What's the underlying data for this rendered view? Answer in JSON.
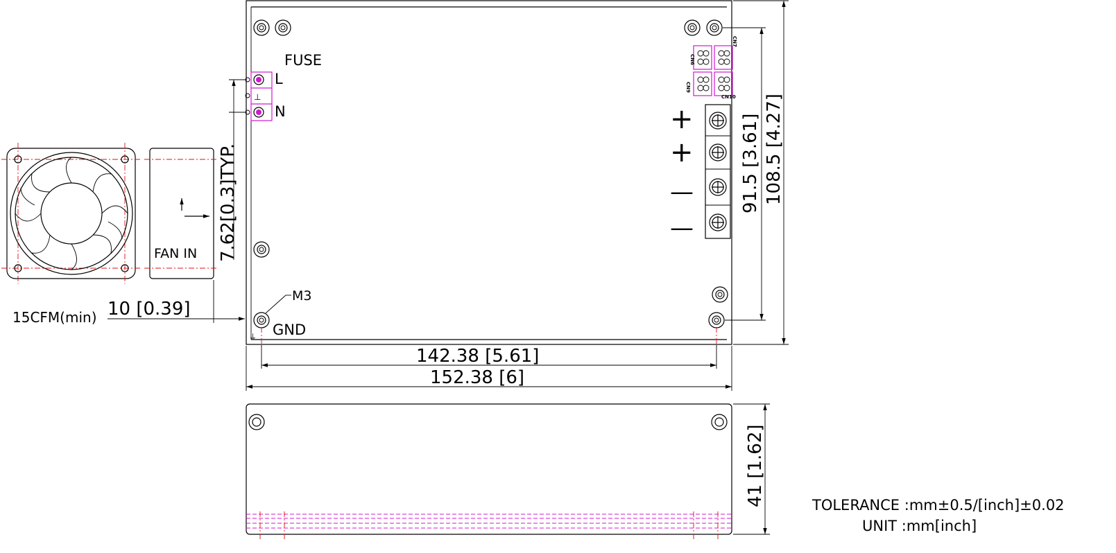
{
  "labels": {
    "fuse": "FUSE",
    "line": "L",
    "neutral": "N",
    "fan_in": "FAN IN",
    "screw": "M3",
    "ground": "GND",
    "airflow": "15CFM(min)",
    "plus_1": "+",
    "plus_2": "+",
    "minus_1": "—",
    "minus_2": "—",
    "cn6": "CN6",
    "cn7": "CN7",
    "cn9": "CN9",
    "cn10": "CN10"
  },
  "dimensions": {
    "fan_gap": "10 [0.39]",
    "terminal_pitch": "7.62[0.3]TYP.",
    "mount_span_width": "142.38 [5.61]",
    "overall_width": "152.38 [6]",
    "mount_span_depth": "91.5 [3.61]",
    "overall_depth": "108.5 [4.27]",
    "height": "41 [1.62]"
  },
  "notes": {
    "tolerance": "TOLERANCE :mm±0.5/[inch]±0.02",
    "unit": "UNIT :mm[inch]"
  },
  "colors": {
    "outline": "#000000",
    "connector": "#d018d0",
    "centerline": "#e01010"
  }
}
